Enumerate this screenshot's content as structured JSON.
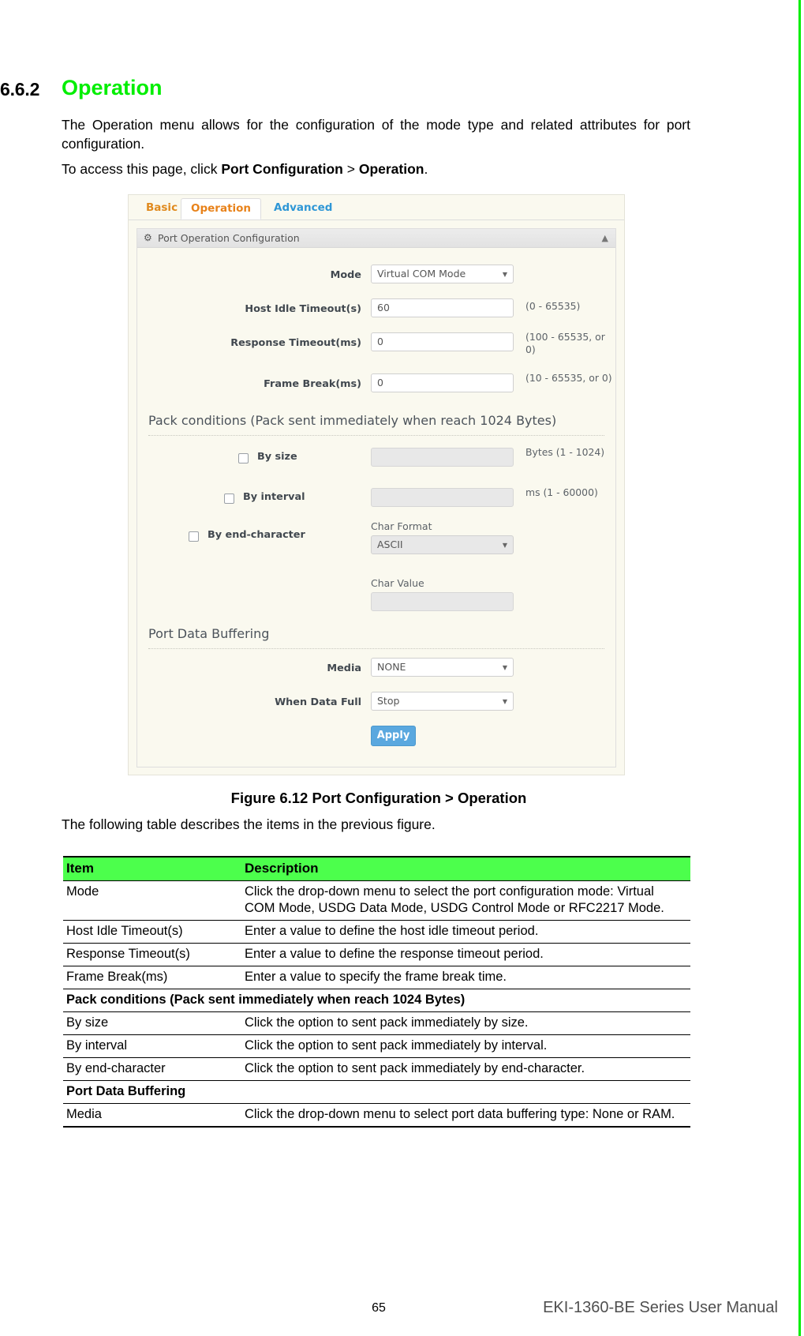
{
  "document": {
    "section_number": "6.6.2",
    "section_title": "Operation",
    "paragraph_1": "The Operation menu allows for the configuration of the mode type and related attributes for port configuration.",
    "paragraph_2_prefix": "To access this page, click ",
    "paragraph_2_bold_1": "Port Configuration",
    "paragraph_2_sep": " > ",
    "paragraph_2_bold_2": "Operation",
    "paragraph_2_suffix": ".",
    "figure_caption": "Figure 6.12 Port Configuration > Operation",
    "table_intro": "The following table describes the items in the previous figure.",
    "page_number": "65",
    "manual_name": "EKI-1360-BE Series User Manual"
  },
  "screenshot": {
    "tabs": [
      {
        "label": "Basic",
        "active": false
      },
      {
        "label": "Operation",
        "active": true
      },
      {
        "label": "Advanced",
        "active": false
      }
    ],
    "panel": {
      "title": "Port Operation Configuration",
      "gear_icon": "gear-icon",
      "collapse_icon": "chevron-up-icon"
    },
    "fields": {
      "mode": {
        "label": "Mode",
        "value": "Virtual COM Mode"
      },
      "host_idle_timeout": {
        "label": "Host Idle Timeout(s)",
        "value": "60",
        "hint": "(0 - 65535)"
      },
      "response_timeout": {
        "label": "Response Timeout(ms)",
        "value": "0",
        "hint": "(100 - 65535, or 0)"
      },
      "frame_break": {
        "label": "Frame Break(ms)",
        "value": "0",
        "hint": "(10 - 65535, or 0)"
      }
    },
    "pack_conditions": {
      "heading": "Pack conditions (Pack sent immediately when reach 1024 Bytes)",
      "by_size": {
        "label": "By size",
        "value": "",
        "hint": "Bytes (1 - 1024)",
        "checked": false
      },
      "by_interval": {
        "label": "By interval",
        "value": "",
        "hint": "ms (1 - 60000)",
        "checked": false
      },
      "by_end_character": {
        "label": "By end-character",
        "checked": false
      },
      "char_format": {
        "label": "Char Format",
        "value": "ASCII"
      },
      "char_value": {
        "label": "Char Value",
        "value": ""
      }
    },
    "port_data_buffering": {
      "heading": "Port Data Buffering",
      "media": {
        "label": "Media",
        "value": "NONE"
      },
      "when_data_full": {
        "label": "When Data Full",
        "value": "Stop"
      }
    },
    "apply_button": "Apply",
    "accent_colors": {
      "tab_orange": "#e8821a",
      "tab_blue": "#2f97d6",
      "panel_bg": "#faf9ef",
      "apply_blue": "#5aa8df"
    }
  },
  "table": {
    "headers": [
      "Item",
      "Description"
    ],
    "header_bg": "#4cff4c",
    "rows": [
      {
        "type": "row",
        "item": "Mode",
        "description": "Click the drop-down menu to select the port configuration mode: Virtual COM Mode, USDG Data Mode, USDG Control Mode or RFC2217 Mode."
      },
      {
        "type": "row",
        "item": "Host Idle Timeout(s)",
        "description": "Enter a value to define the host idle timeout period."
      },
      {
        "type": "row",
        "item": "Response Timeout(s)",
        "description": "Enter a value to define the response timeout period."
      },
      {
        "type": "row",
        "item": "Frame Break(ms)",
        "description": "Enter a value to specify the frame break time."
      },
      {
        "type": "group",
        "item": "Pack conditions (Pack sent immediately when reach 1024 Bytes)",
        "description": ""
      },
      {
        "type": "row",
        "item": "By size",
        "description": "Click the option to sent pack immediately by size."
      },
      {
        "type": "row",
        "item": "By interval",
        "description": "Click the option to sent pack immediately by interval."
      },
      {
        "type": "row",
        "item": "By end-character",
        "description": "Click the option to sent pack immediately by end-character."
      },
      {
        "type": "group",
        "item": "Port Data Buffering",
        "description": ""
      },
      {
        "type": "row",
        "item": "Media",
        "description": "Click the drop-down menu to select port data buffering type: None or RAM."
      }
    ]
  }
}
